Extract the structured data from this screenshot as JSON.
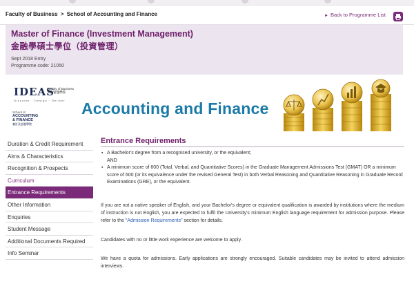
{
  "header": {
    "breadcrumb": [
      "Faculty of Business",
      "School of Accounting and Finance"
    ],
    "breadcrumb_separator": ">",
    "back_link": "Back to Programme List"
  },
  "programme": {
    "title_en": "Master of Finance (Investment Management)",
    "title_zh": "金融學碩士學位（投資管理）",
    "entry": "Sept 2018 Entry",
    "code": "Programme code: 21050"
  },
  "banner": {
    "title": "Accounting and Finance",
    "ideas_logo": {
      "word": "IDEAS",
      "faculty": "Faculty of Business",
      "chinese": "工商管理學院",
      "tagline": "Discover · Design · Deliver"
    },
    "school_logo": {
      "line1": "School of",
      "line2": "ACCOUNTING",
      "line3": "& FINANCE",
      "line4": "會計及金融學院"
    }
  },
  "sidebar": {
    "items": [
      {
        "label": "Duration & Credit Requirement"
      },
      {
        "label": "Aims & Characteristics"
      },
      {
        "label": "Recognition & Prospects"
      },
      {
        "label": "Curriculum"
      },
      {
        "label": "Entrance Requirements"
      },
      {
        "label": "Other Information"
      },
      {
        "label": "Enquiries"
      },
      {
        "label": "Student Message"
      },
      {
        "label": "Additional Documents Required"
      },
      {
        "label": "Info Seminar"
      }
    ]
  },
  "content": {
    "section_title": "Entrance Requirements",
    "requirement_1": "A Bachelor's degree from a recognised university, or the equivalent;",
    "and_text": "AND",
    "requirement_2": "A minimum score of 600 (Total, Verbal, and Quantitative Scores) in the Graduate Management Admissions Test (GMAT) OR a minimum score of 600 (or its equivalence under the revised General Test) in both Verbal Reasoning and Quantitative Reasoning in Graduate Record Examinations (GRE), or the equivalent.",
    "para1_before": "If you are not a native speaker of English, and your Bachelor's degree or equivalent qualification is awarded by institutions where the medium of instruction is not English, you are expected to fulfil the University's minimum English language requirement for admission purpose. Please refer to the ",
    "para1_link": "\"Admission Requirements\"",
    "para1_after": " section for details.",
    "para2": "Candidates with no or little work experience are welcome to apply.",
    "para3": "We have a quota for admissions. Early applications are strongly encouraged. Suitable candidates may be invited to attend admission interviews."
  },
  "colors": {
    "brand_purple": "#7a2a78",
    "title_purple": "#6d1f6a",
    "title_bg": "#ece4ee",
    "banner_blue": "#1c7aa8",
    "link_blue": "#2a5db0",
    "gold": "#d9a521"
  }
}
